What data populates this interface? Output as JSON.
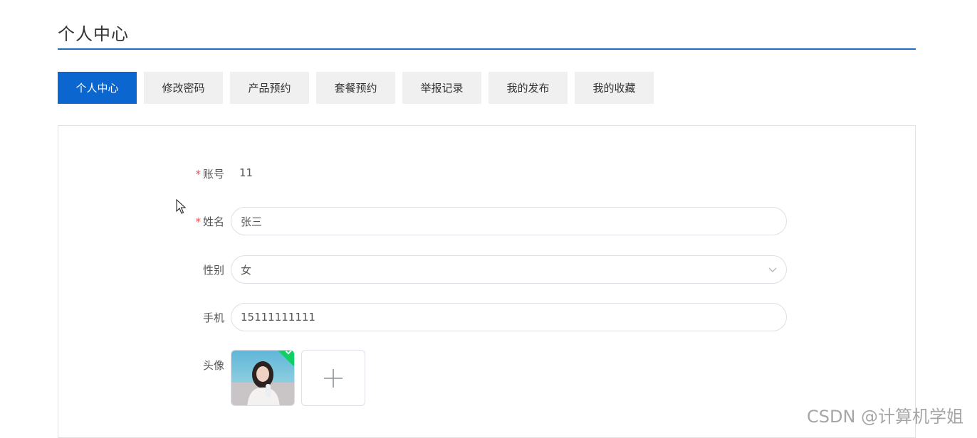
{
  "page": {
    "title": "个人中心"
  },
  "tabs": [
    {
      "label": "个人中心",
      "active": true
    },
    {
      "label": "修改密码",
      "active": false
    },
    {
      "label": "产品预约",
      "active": false
    },
    {
      "label": "套餐预约",
      "active": false
    },
    {
      "label": "举报记录",
      "active": false
    },
    {
      "label": "我的发布",
      "active": false
    },
    {
      "label": "我的收藏",
      "active": false
    }
  ],
  "form": {
    "account": {
      "required_mark": "*",
      "label": "账号",
      "value": "11"
    },
    "name": {
      "required_mark": "*",
      "label": "姓名",
      "value": "张三"
    },
    "gender": {
      "label": "性别",
      "value": "女"
    },
    "phone": {
      "label": "手机",
      "value": "15111111111"
    },
    "avatar": {
      "label": "头像"
    }
  },
  "watermark": "CSDN @计算机学姐",
  "colors": {
    "accent": "#0b66d0",
    "rule": "#1e6fc3",
    "required": "#e45656",
    "success": "#13ce66"
  },
  "icons": {
    "select": "chevron-down-icon",
    "upload": "plus-icon",
    "uploaded": "check-icon",
    "cursor": "mouse-pointer-icon"
  }
}
